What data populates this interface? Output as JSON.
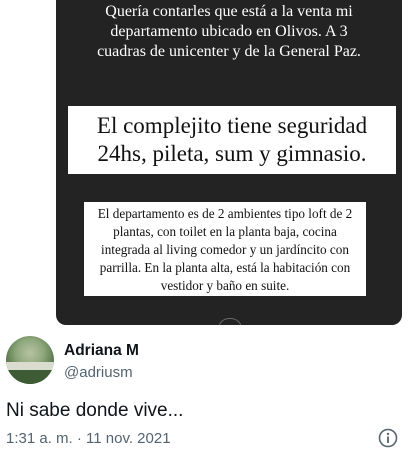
{
  "story": {
    "top_text": "Quería contarles que está a la venta mi departamento ubicado en Olivos. A 3 cuadras de unicenter y de la General Paz.",
    "highlight_line1": "El complejito tiene seguridad",
    "highlight_line2": "24hs, pileta, sum y gimnasio.",
    "description": "El departamento es de 2 ambientes tipo loft de 2 plantas, con toilet en la planta baja, cocina integrada al living comedor y un jardíncito con parrilla. En la planta alta, está la habitación con vestidor y baño en suite."
  },
  "author": {
    "name": "Adriana M",
    "handle": "@adriusm"
  },
  "tweet": {
    "text": "Ni sabe donde vive...",
    "timestamp": "1:31 a. m. · 11 nov. 2021"
  },
  "icons": {
    "info": "info-icon"
  }
}
